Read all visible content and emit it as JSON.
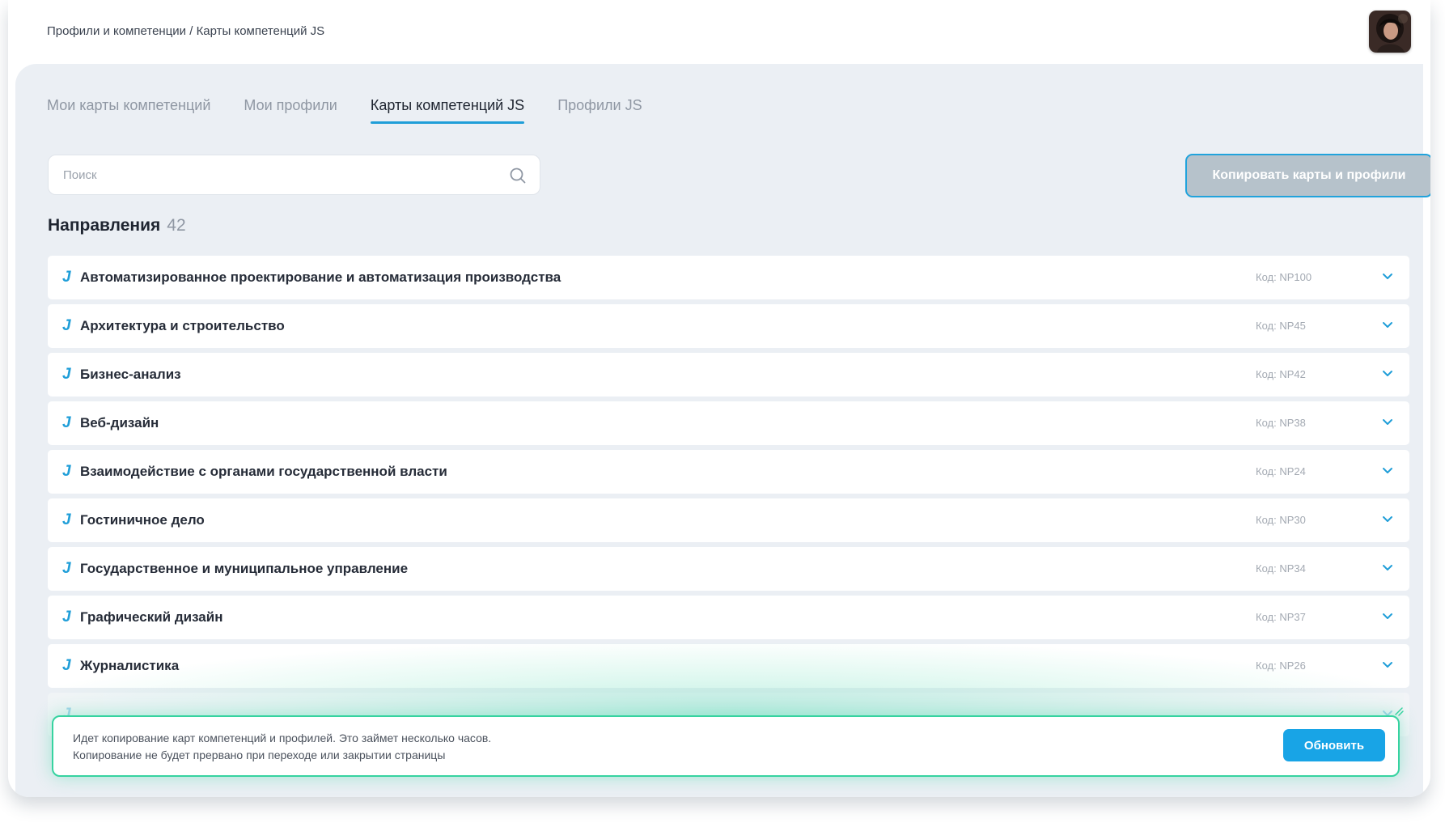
{
  "breadcrumb": "Профили и компетенции / Карты компетенций JS",
  "tabs": [
    {
      "label": "Мои карты компетенций",
      "active": false
    },
    {
      "label": "Мои профили",
      "active": false
    },
    {
      "label": "Карты компетенций JS",
      "active": true
    },
    {
      "label": "Профили JS",
      "active": false
    }
  ],
  "search": {
    "placeholder": "Поиск"
  },
  "copy_button": "Копировать карты и профили",
  "section": {
    "title": "Направления",
    "count": "42"
  },
  "row_marker": "J",
  "directions": [
    {
      "name": "Автоматизированное проектирование и автоматизация производства",
      "code": "Код: NP100"
    },
    {
      "name": "Архитектура и строительство",
      "code": "Код: NP45"
    },
    {
      "name": "Бизнес-анализ",
      "code": "Код: NP42"
    },
    {
      "name": "Веб-дизайн",
      "code": "Код: NP38"
    },
    {
      "name": "Взаимодействие с органами государственной власти",
      "code": "Код: NP24"
    },
    {
      "name": "Гостиничное дело",
      "code": "Код: NP30"
    },
    {
      "name": "Государственное и муниципальное управление",
      "code": "Код: NP34"
    },
    {
      "name": "Графический дизайн",
      "code": "Код: NP37"
    },
    {
      "name": "Журналистика",
      "code": "Код: NP26"
    }
  ],
  "toast": {
    "line1": "Идет копирование карт компетенций и профилей. Это займет несколько часов.",
    "line2": "Копирование не будет прервано при переходе или закрытии страницы",
    "button": "Обновить"
  },
  "colors": {
    "accent": "#1f9ed8",
    "toast_border": "#36d3a0",
    "refresh_button": "#18a4e6",
    "copy_button_bg": "#b6c2cb"
  }
}
